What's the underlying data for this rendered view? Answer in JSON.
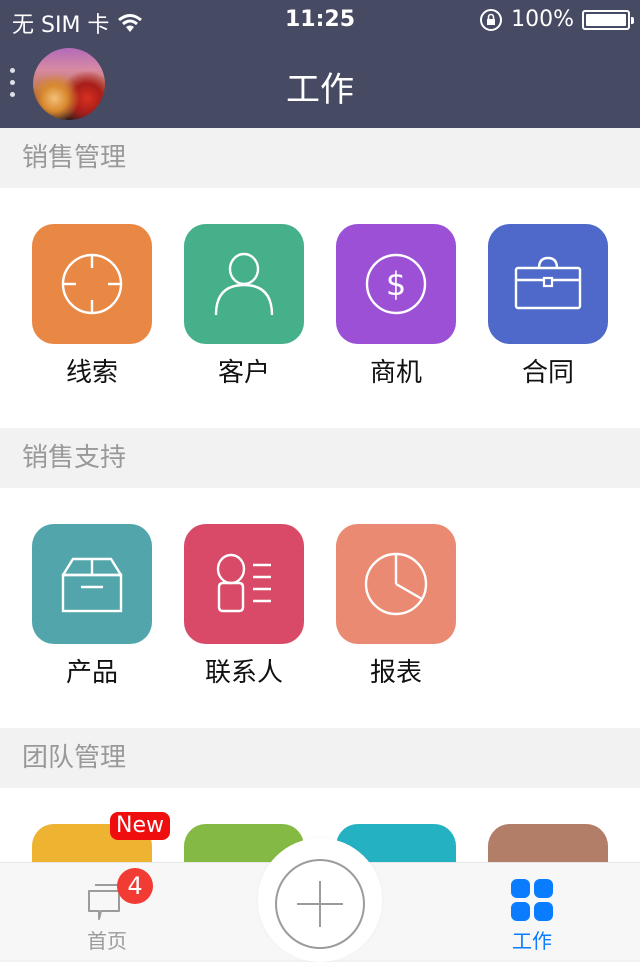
{
  "status_bar": {
    "carrier": "无 SIM 卡",
    "time": "11:25",
    "battery_percent": "100%",
    "battery_level": 1.0,
    "icons": [
      "wifi-icon",
      "rotation-lock-icon",
      "battery-icon"
    ]
  },
  "nav": {
    "title": "工作",
    "menu_icon": "vertical-dots-icon",
    "avatar": "city-night-avatar"
  },
  "sections": [
    {
      "title": "销售管理",
      "items": [
        {
          "label": "线索",
          "icon": "target-icon",
          "color": "#e98845"
        },
        {
          "label": "客户",
          "icon": "person-icon",
          "color": "#45b08a"
        },
        {
          "label": "商机",
          "icon": "dollar-coin-icon",
          "color": "#9c50d6"
        },
        {
          "label": "合同",
          "icon": "briefcase-icon",
          "color": "#4e69c9"
        }
      ]
    },
    {
      "title": "销售支持",
      "items": [
        {
          "label": "产品",
          "icon": "box-icon",
          "color": "#52a6ab"
        },
        {
          "label": "联系人",
          "icon": "contact-card-icon",
          "color": "#d94a68"
        },
        {
          "label": "报表",
          "icon": "pie-chart-icon",
          "color": "#ea8a73"
        }
      ]
    },
    {
      "title": "团队管理",
      "items": [
        {
          "label": "",
          "icon": "partial-icon",
          "color": "#eeb431",
          "badge": "New"
        },
        {
          "label": "",
          "icon": "partial-icon",
          "color": "#84ba44"
        },
        {
          "label": "",
          "icon": "partial-icon",
          "color": "#24b2c3"
        },
        {
          "label": "",
          "icon": "partial-icon",
          "color": "#b27e67"
        }
      ]
    }
  ],
  "tabbar": {
    "home": {
      "label": "首页",
      "badge": "4",
      "icon": "chat-bubbles-icon"
    },
    "add": {
      "icon": "plus-icon"
    },
    "work": {
      "label": "工作",
      "icon": "grid-icon",
      "active_color": "#0a7cff"
    }
  }
}
